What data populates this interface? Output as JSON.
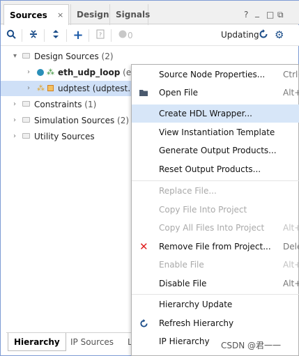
{
  "tabs": {
    "sources": "Sources",
    "close": "×",
    "design": "Design",
    "signals": "Signals",
    "help": "?",
    "minimize": "_",
    "maximize": "□",
    "restore": "⧉"
  },
  "toolbar": {
    "count": "0",
    "status": "Updating"
  },
  "tree": {
    "design_sources": "Design Sources",
    "design_sources_count": "(2)",
    "eth_name": "eth_udp_loop",
    "eth_rest": "(eth_",
    "udptest": "udptest (udptest.bd)",
    "constraints": "Constraints",
    "constraints_count": "(1)",
    "simulation": "Simulation Sources",
    "simulation_count": "(2)",
    "utility": "Utility Sources"
  },
  "bottom_tabs": {
    "hierarchy": "Hierarchy",
    "ip_sources": "IP Sources",
    "lib": "Lib"
  },
  "menu": {
    "items": [
      {
        "label": "Source Node Properties...",
        "shortcut": "Ctrl+"
      },
      {
        "label": "Open File",
        "shortcut": "Alt+O"
      },
      {
        "label": "Create HDL Wrapper...",
        "shortcut": ""
      },
      {
        "label": "View Instantiation Template",
        "shortcut": ""
      },
      {
        "label": "Generate Output Products...",
        "shortcut": ""
      },
      {
        "label": "Reset Output Products...",
        "shortcut": ""
      },
      {
        "label": "Replace File...",
        "shortcut": ""
      },
      {
        "label": "Copy File Into Project",
        "shortcut": ""
      },
      {
        "label": "Copy All Files Into Project",
        "shortcut": "Alt+I"
      },
      {
        "label": "Remove File from Project...",
        "shortcut": "Dele"
      },
      {
        "label": "Enable File",
        "shortcut": "Alt+="
      },
      {
        "label": "Disable File",
        "shortcut": "Alt+-"
      },
      {
        "label": "Hierarchy Update",
        "shortcut": ""
      },
      {
        "label": "Refresh Hierarchy",
        "shortcut": ""
      },
      {
        "label": "IP Hierarchy",
        "shortcut": ""
      }
    ]
  },
  "watermark": "CSDN @君一一",
  "colors": {
    "accent_blue": "#1c5aa8",
    "selection": "#cfe0f7",
    "menu_highlight": "#d7e6f8",
    "remove_red": "#e02020",
    "panel_border": "#7d9bd4"
  }
}
